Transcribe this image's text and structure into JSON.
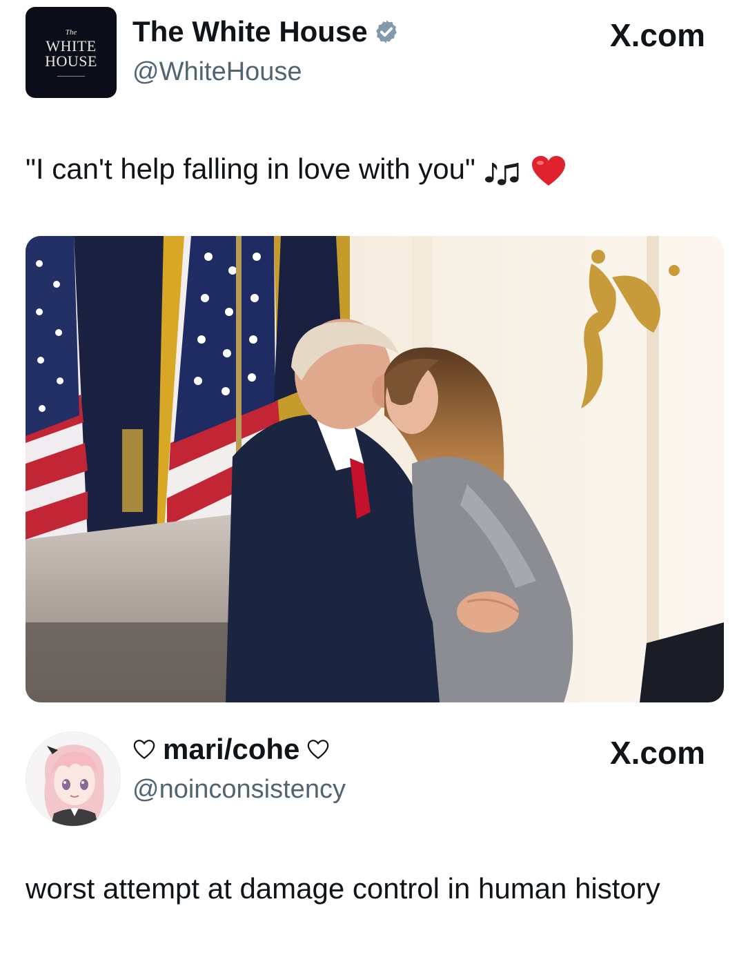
{
  "post1": {
    "avatar": {
      "line1": "The",
      "line2": "WHITE",
      "line3": "HOUSE"
    },
    "display_name": "The White House",
    "verified_icon": "verified-badge-icon",
    "handle": "@WhiteHouse",
    "source": "X.com",
    "text": "\"I can't help falling in love with you\"",
    "emojis": [
      "musical-notes-icon",
      "red-heart-icon"
    ],
    "photo_icon": "photo-couple-embrace"
  },
  "post2": {
    "display_name": "mari/cohe",
    "name_decoration": "heart-outline-icon",
    "handle": "@noinconsistency",
    "source": "X.com",
    "text": "worst attempt at damage control in human history"
  },
  "colors": {
    "text": "#0f1419",
    "handle": "#536471",
    "verified": "#829aab",
    "heart": "#e0212e"
  }
}
